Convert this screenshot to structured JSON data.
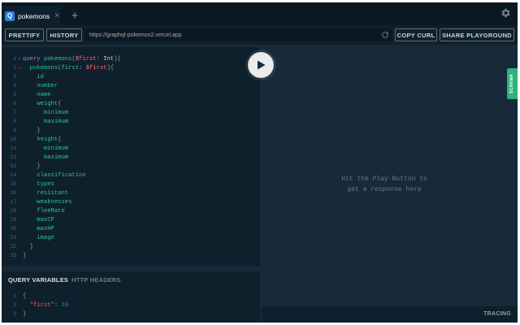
{
  "tab": {
    "icon_letter": "Q",
    "label": "pokemons",
    "close": "×",
    "add": "+"
  },
  "toolbar": {
    "prettify": "PRETTIFY",
    "history": "HISTORY",
    "url": "https://graphql-pokemon2.vercel.app",
    "copy_curl": "COPY CURL",
    "share": "SHARE PLAYGROUND"
  },
  "query_lines": [
    {
      "n": "1",
      "fold": true,
      "segs": [
        {
          "c": "kw",
          "t": "query "
        },
        {
          "c": "code",
          "t": "pokemons"
        },
        {
          "c": "punct",
          "t": "("
        },
        {
          "c": "var",
          "t": "$first"
        },
        {
          "c": "punct",
          "t": ": "
        },
        {
          "c": "typ",
          "t": "Int"
        },
        {
          "c": "punct",
          "t": "){"
        }
      ]
    },
    {
      "n": "2",
      "fold": true,
      "segs": [
        {
          "c": "code",
          "t": "  pokemons"
        },
        {
          "c": "punct",
          "t": "("
        },
        {
          "c": "code",
          "t": "first"
        },
        {
          "c": "punct",
          "t": ": "
        },
        {
          "c": "var",
          "t": "$first"
        },
        {
          "c": "punct",
          "t": "){"
        }
      ]
    },
    {
      "n": "3",
      "segs": [
        {
          "c": "code",
          "t": "    id"
        }
      ]
    },
    {
      "n": "4",
      "segs": [
        {
          "c": "code",
          "t": "    number"
        }
      ]
    },
    {
      "n": "5",
      "segs": [
        {
          "c": "code",
          "t": "    name"
        }
      ]
    },
    {
      "n": "6",
      "segs": [
        {
          "c": "code",
          "t": "    weight"
        },
        {
          "c": "punct",
          "t": "{"
        }
      ]
    },
    {
      "n": "7",
      "segs": [
        {
          "c": "code",
          "t": "      minimum"
        }
      ]
    },
    {
      "n": "8",
      "segs": [
        {
          "c": "code",
          "t": "      maximum"
        }
      ]
    },
    {
      "n": "9",
      "segs": [
        {
          "c": "punct",
          "t": "    }"
        }
      ]
    },
    {
      "n": "10",
      "segs": [
        {
          "c": "code",
          "t": "    height"
        },
        {
          "c": "punct",
          "t": "{"
        }
      ]
    },
    {
      "n": "11",
      "segs": [
        {
          "c": "code",
          "t": "      minimum"
        }
      ]
    },
    {
      "n": "12",
      "segs": [
        {
          "c": "code",
          "t": "      maximum"
        }
      ]
    },
    {
      "n": "13",
      "segs": [
        {
          "c": "punct",
          "t": "    }"
        }
      ]
    },
    {
      "n": "14",
      "segs": [
        {
          "c": "code",
          "t": "    classification"
        }
      ]
    },
    {
      "n": "15",
      "segs": [
        {
          "c": "code",
          "t": "    types"
        }
      ]
    },
    {
      "n": "16",
      "segs": [
        {
          "c": "code",
          "t": "    resistant"
        }
      ]
    },
    {
      "n": "17",
      "segs": [
        {
          "c": "code",
          "t": "    weaknesses"
        }
      ]
    },
    {
      "n": "18",
      "segs": [
        {
          "c": "code",
          "t": "    fleeRate"
        }
      ]
    },
    {
      "n": "19",
      "segs": [
        {
          "c": "code",
          "t": "    maxCP"
        }
      ]
    },
    {
      "n": "20",
      "segs": [
        {
          "c": "code",
          "t": "    maxHP"
        }
      ]
    },
    {
      "n": "21",
      "segs": [
        {
          "c": "code",
          "t": "    image"
        }
      ]
    },
    {
      "n": "22",
      "segs": [
        {
          "c": "punct",
          "t": "  }"
        }
      ]
    },
    {
      "n": "23",
      "segs": [
        {
          "c": "punct",
          "t": "}"
        }
      ]
    }
  ],
  "variables": {
    "tab_query_vars": "QUERY VARIABLES",
    "tab_http_headers": "HTTP HEADERS",
    "lines": [
      {
        "n": "1",
        "segs": [
          {
            "c": "punct",
            "t": "{"
          }
        ]
      },
      {
        "n": "2",
        "segs": [
          {
            "c": "str",
            "t": "  \"first\""
          },
          {
            "c": "punct",
            "t": ": "
          },
          {
            "c": "num",
            "t": "10"
          }
        ]
      },
      {
        "n": "3",
        "segs": [
          {
            "c": "punct",
            "t": "}"
          }
        ]
      }
    ]
  },
  "result": {
    "hint_line1": "Hit the Play Button to",
    "hint_line2": "get a response here",
    "schema_tab": "SCHEMA",
    "tracing": "TRACING"
  },
  "icons": {
    "tab": "graphql-q-icon",
    "settings": "gear-icon",
    "reload": "reload-icon",
    "play": "play-icon"
  }
}
